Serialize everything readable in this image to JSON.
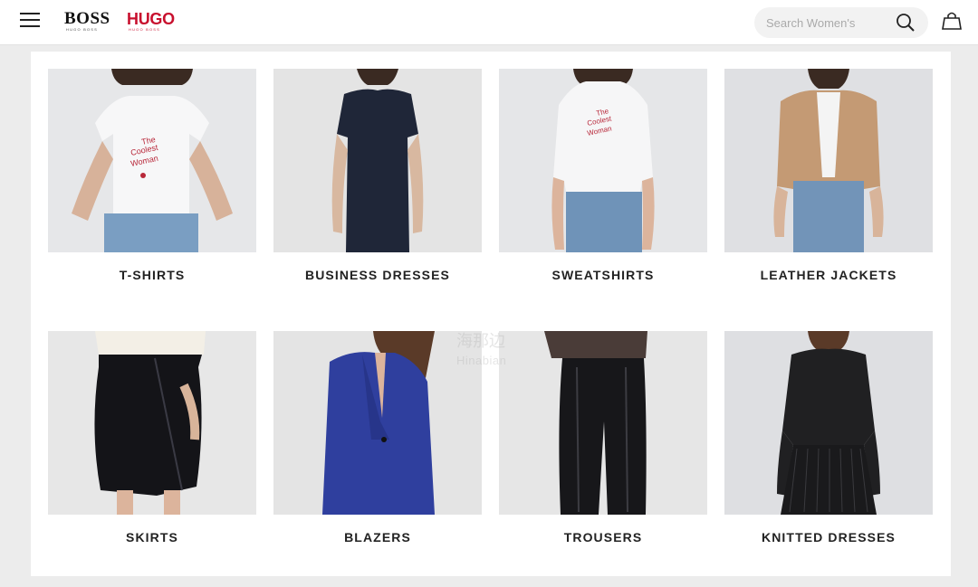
{
  "header": {
    "brand_boss": "BOSS",
    "brand_boss_sub": "HUGO BOSS",
    "brand_hugo": "HUGO",
    "brand_hugo_sub": "HUGO BOSS",
    "search_placeholder": "Search Women's",
    "icons": {
      "menu": "hamburger-menu-icon",
      "search": "search-icon",
      "bag": "shopping-bag-icon"
    },
    "accent_color": "#c8102e"
  },
  "categories": [
    {
      "label": "T-SHIRTS",
      "image": "woman-in-white-graphic-tshirt"
    },
    {
      "label": "BUSINESS DRESSES",
      "image": "woman-in-navy-sheath-dress"
    },
    {
      "label": "SWEATSHIRTS",
      "image": "woman-in-white-graphic-hoodie"
    },
    {
      "label": "LEATHER JACKETS",
      "image": "woman-in-tan-leather-jacket"
    },
    {
      "label": "SKIRTS",
      "image": "black-textured-wrap-skirt"
    },
    {
      "label": "BLAZERS",
      "image": "woman-in-cobalt-blue-blazer"
    },
    {
      "label": "TROUSERS",
      "image": "black-leather-trousers"
    },
    {
      "label": "KNITTED DRESSES",
      "image": "woman-in-black-knitted-dress"
    }
  ],
  "watermark": {
    "line1": "海那边",
    "line2": "Hinabian"
  }
}
